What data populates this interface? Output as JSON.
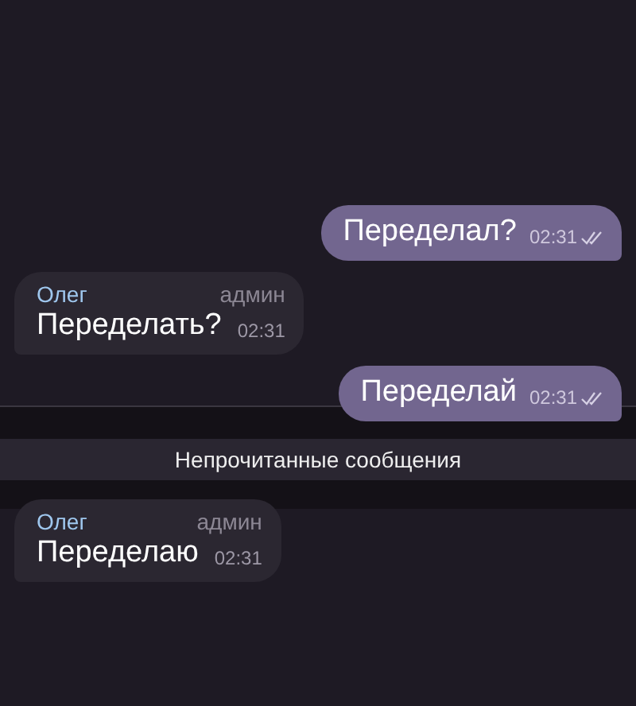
{
  "messages": [
    {
      "kind": "outgoing",
      "text": "Переделал?",
      "time": "02:31",
      "read": true
    },
    {
      "kind": "incoming",
      "sender": "Олег",
      "role": "админ",
      "text": "Переделать?",
      "time": "02:31"
    },
    {
      "kind": "outgoing",
      "text": "Переделай",
      "time": "02:31",
      "read": true
    },
    {
      "kind": "divider",
      "text": "Непрочитанные сообщения"
    },
    {
      "kind": "incoming",
      "sender": "Олег",
      "role": "админ",
      "text": "Переделаю",
      "time": "02:31"
    }
  ]
}
